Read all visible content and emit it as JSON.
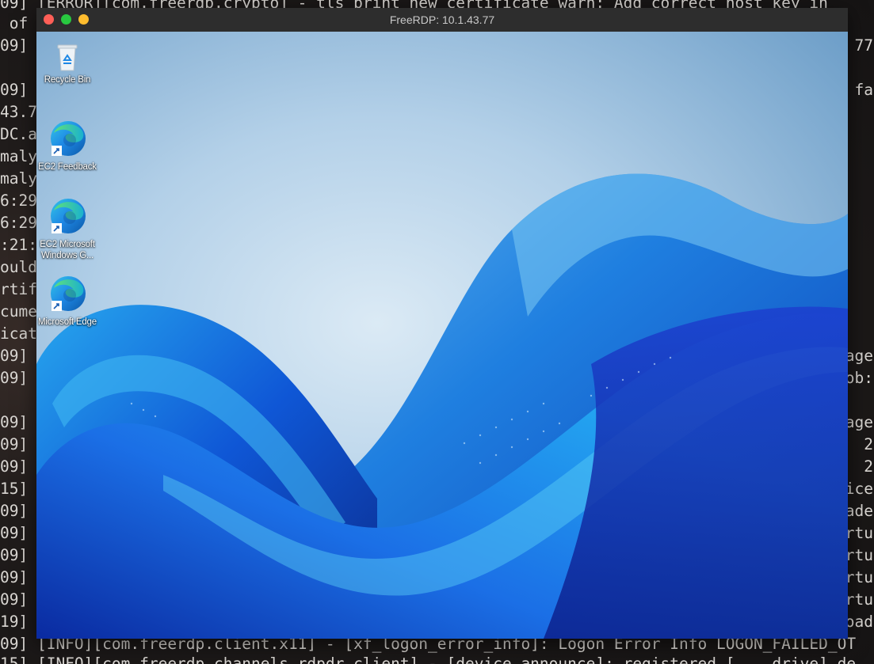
{
  "window": {
    "title": "FreeRDP: 10.1.43.77"
  },
  "desktop": {
    "icons": [
      {
        "label": "Recycle Bin",
        "icon": "recycle-bin-icon"
      },
      {
        "label": "EC2 Feedback",
        "icon": "edge-shortcut-icon"
      },
      {
        "label": "EC2 Microsoft Windows G...",
        "icon": "edge-shortcut-icon"
      },
      {
        "label": "Microsoft Edge",
        "icon": "edge-shortcut-icon"
      }
    ]
  },
  "terminal": {
    "lines": [
      {
        "left": "09] [ERROR][com.freerdp.crypto] - tls_print_new_certificate_warn: Add correct host key in",
        "right": ""
      },
      {
        "left": " of",
        "right": ""
      },
      {
        "left": "09]",
        "right": "77"
      },
      {
        "left": "",
        "right": ""
      },
      {
        "left": "09]",
        "right": "fa"
      },
      {
        "left": "43.7",
        "right": ""
      },
      {
        "left": "DC.a",
        "right": ""
      },
      {
        "left": "maly",
        "right": ""
      },
      {
        "left": "maly",
        "right": ""
      },
      {
        "left": "6:29",
        "right": ""
      },
      {
        "left": "6:29",
        "right": ""
      },
      {
        "left": ":21:",
        "right": ""
      },
      {
        "left": "ould",
        "right": ""
      },
      {
        "left": "rtif",
        "right": ""
      },
      {
        "left": "cume",
        "right": ""
      },
      {
        "left": "icat",
        "right": ""
      },
      {
        "left": "09]",
        "right": "age"
      },
      {
        "left": "09]",
        "right": "ob:"
      },
      {
        "left": "",
        "right": ""
      },
      {
        "left": "09]",
        "right": "age"
      },
      {
        "left": "09]",
        "right": "2"
      },
      {
        "left": "09]",
        "right": "2"
      },
      {
        "left": "15]",
        "right": "ice"
      },
      {
        "left": "09]",
        "right": "ade"
      },
      {
        "left": "09]",
        "right": "rtu"
      },
      {
        "left": "09]",
        "right": "rtu"
      },
      {
        "left": "09]",
        "right": "rtu"
      },
      {
        "left": "09]",
        "right": "rtu"
      },
      {
        "left": "19]",
        "right": "oad"
      },
      {
        "left": "09] [INFO][com.freerdp.client.x11] - [xf_logon_error_info]: Logon Error Info LOGON_FAILED_OT",
        "right": ""
      },
      {
        "left": "15] [INFO][com.freerdp.channels.rdpdr.client] - [device_announce]: registered [    drive] de",
        "right": ""
      }
    ]
  },
  "colors": {
    "title_bar": "#2d2d2d",
    "close": "#ff5f57",
    "maximize": "#28c840",
    "minimize": "#febc2e",
    "wallpaper_blue": "#1e56e0"
  }
}
